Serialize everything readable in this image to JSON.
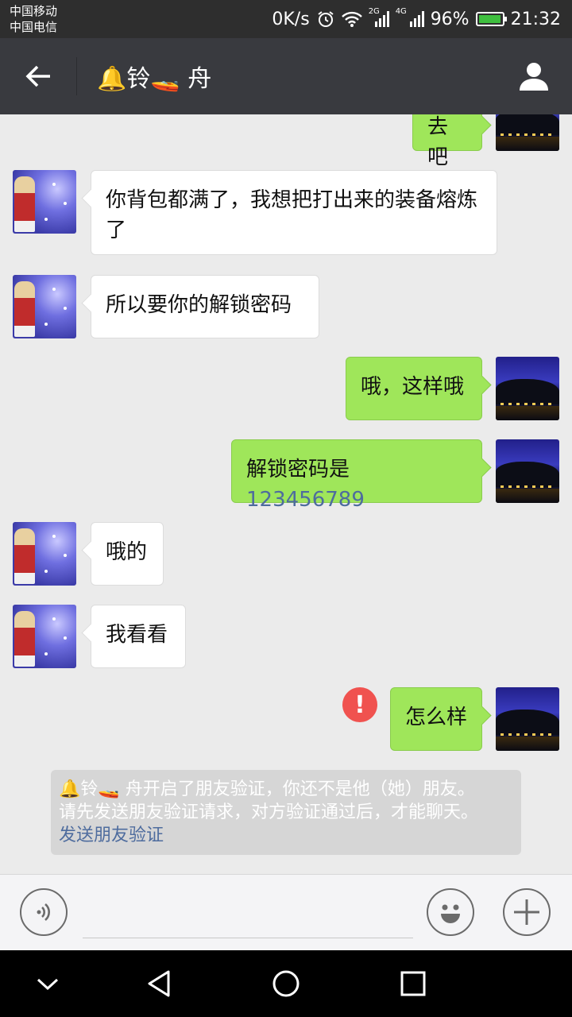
{
  "status_bar": {
    "carrier_1": "中国移动",
    "carrier_2": "中国电信",
    "speed": "0K/s",
    "battery": "96%",
    "battery_fraction": 0.96,
    "time": "21:32",
    "net_2g": "2G",
    "net_4g": "4G"
  },
  "header": {
    "title": "🔔铃🚤 舟",
    "back_icon": "arrow-left-icon",
    "profile_icon": "person-icon"
  },
  "messages": [
    {
      "side": "right",
      "text": "去吧"
    },
    {
      "side": "left",
      "text": "你背包都满了，我想把打出来的装备熔炼了"
    },
    {
      "side": "left",
      "text": "所以要你的解锁密码"
    },
    {
      "side": "right",
      "text": "哦，这样哦"
    },
    {
      "side": "right",
      "text": "解锁密码是",
      "number": "123456789"
    },
    {
      "side": "left",
      "text": "哦的"
    },
    {
      "side": "left",
      "text": "我看看"
    },
    {
      "side": "right",
      "text": "怎么样",
      "failed": true
    }
  ],
  "system_notice": {
    "line_1": "🔔铃🚤 舟开启了朋友验证，你还不是他（她）朋友。",
    "line_2": "请先发送朋友验证请求，对方验证通过后，才能聊天。",
    "link": "发送朋友验证"
  },
  "input_bar": {
    "voice_icon": "voice-icon",
    "emoji_icon": "emoji-icon",
    "plus_icon": "plus-icon"
  },
  "nav_bar": {
    "icons": [
      "chevron-down-icon",
      "back-triangle-icon",
      "home-circle-icon",
      "recents-square-icon"
    ]
  },
  "colors": {
    "title_bar": "#393a3f",
    "sent_bubble": "#9fe65a",
    "received_bubble": "#ffffff",
    "error": "#f0524f",
    "link": "#4e6c9e"
  }
}
